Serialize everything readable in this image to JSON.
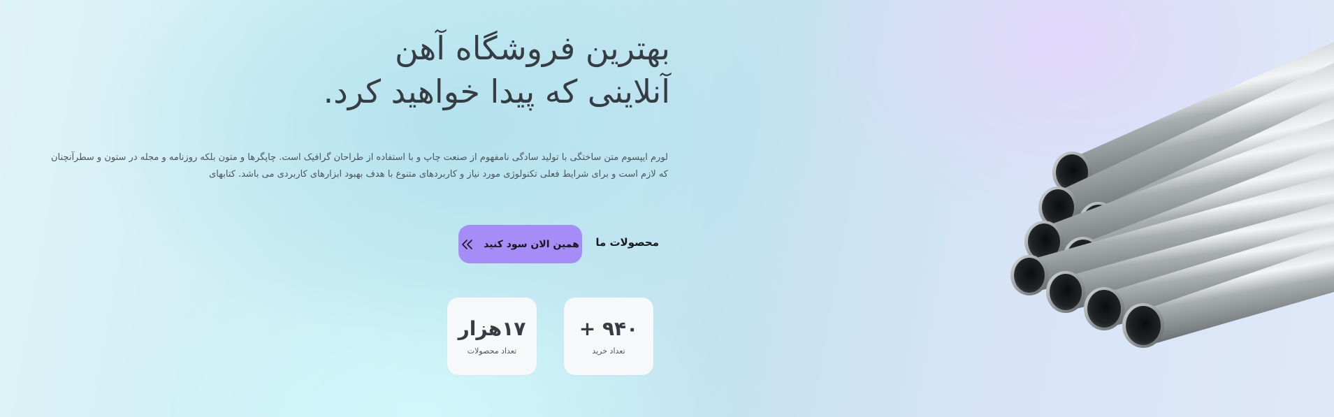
{
  "hero": {
    "title_line_1": "بهترین فروشگاه آهن",
    "title_line_2": "آنلاینی که پیدا خواهید کرد.",
    "description": "لورم ایپسوم متن ساختگی با تولید سادگی نامفهوم از صنعت چاپ و با استفاده از طراحان گرافیک است. چاپگرها و متون بلکه روزنامه و مجله در ستون و سطرآنچنان که لازم است و برای شرایط فعلی تکنولوژی مورد نیاز و کاربردهای متنوع با هدف بهبود ابزارهای کاربردی می باشد. کتابهای"
  },
  "actions": {
    "products_link": "محصولات ما",
    "cta_label": "همین الان سود کنید",
    "cta_icon": "double-chevron-left-icon"
  },
  "stats": [
    {
      "value": "۹۴۰ +",
      "label": "تعداد خرید"
    },
    {
      "value": "۱۷هزار",
      "label": "تعداد محصولات"
    }
  ],
  "image": {
    "subject": "steel-pipes-image"
  },
  "colors": {
    "accent": "#a68cf6",
    "card_bg": "#f6f8fa",
    "title_text": "#363d42"
  }
}
